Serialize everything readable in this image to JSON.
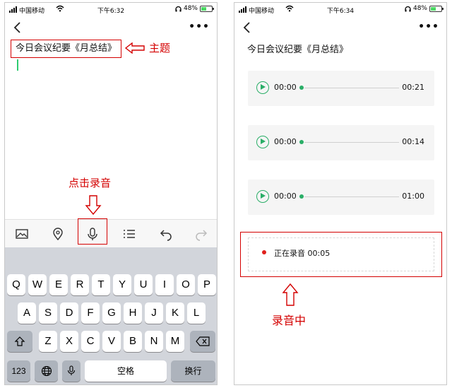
{
  "left": {
    "status": {
      "carrier": "中国移动",
      "time": "下午6:32",
      "battery": "48%"
    },
    "title_text": "今日会议纪要《月总结》",
    "annotation_subject": "主题",
    "annotation_tap": "点击录音",
    "keyboard": {
      "row1": [
        "Q",
        "W",
        "E",
        "R",
        "T",
        "Y",
        "U",
        "I",
        "O",
        "P"
      ],
      "row2": [
        "A",
        "S",
        "D",
        "F",
        "G",
        "H",
        "J",
        "K",
        "L"
      ],
      "row3": [
        "Z",
        "X",
        "C",
        "V",
        "B",
        "N",
        "M"
      ],
      "numbers_key": "123",
      "space_key": "空格",
      "return_key": "换行"
    }
  },
  "right": {
    "status": {
      "carrier": "中国移动",
      "time": "下午6:34",
      "battery": "48%"
    },
    "title_text": "今日会议纪要《月总结》",
    "recordings": [
      {
        "current": "00:00",
        "duration": "00:21"
      },
      {
        "current": "00:00",
        "duration": "00:14"
      },
      {
        "current": "00:00",
        "duration": "01:00"
      }
    ],
    "recording_status": "正在录音 00:05",
    "annotation_recording": "录音中"
  },
  "colors": {
    "accent_red": "#d40000",
    "play_green": "#2aae67",
    "cursor_green": "#2ecc71"
  },
  "icons": [
    "image-icon",
    "location-icon",
    "microphone-icon",
    "list-icon",
    "undo-icon",
    "redo-icon",
    "back-icon",
    "more-icon",
    "play-icon",
    "shift-icon",
    "backspace-icon",
    "globe-icon"
  ]
}
